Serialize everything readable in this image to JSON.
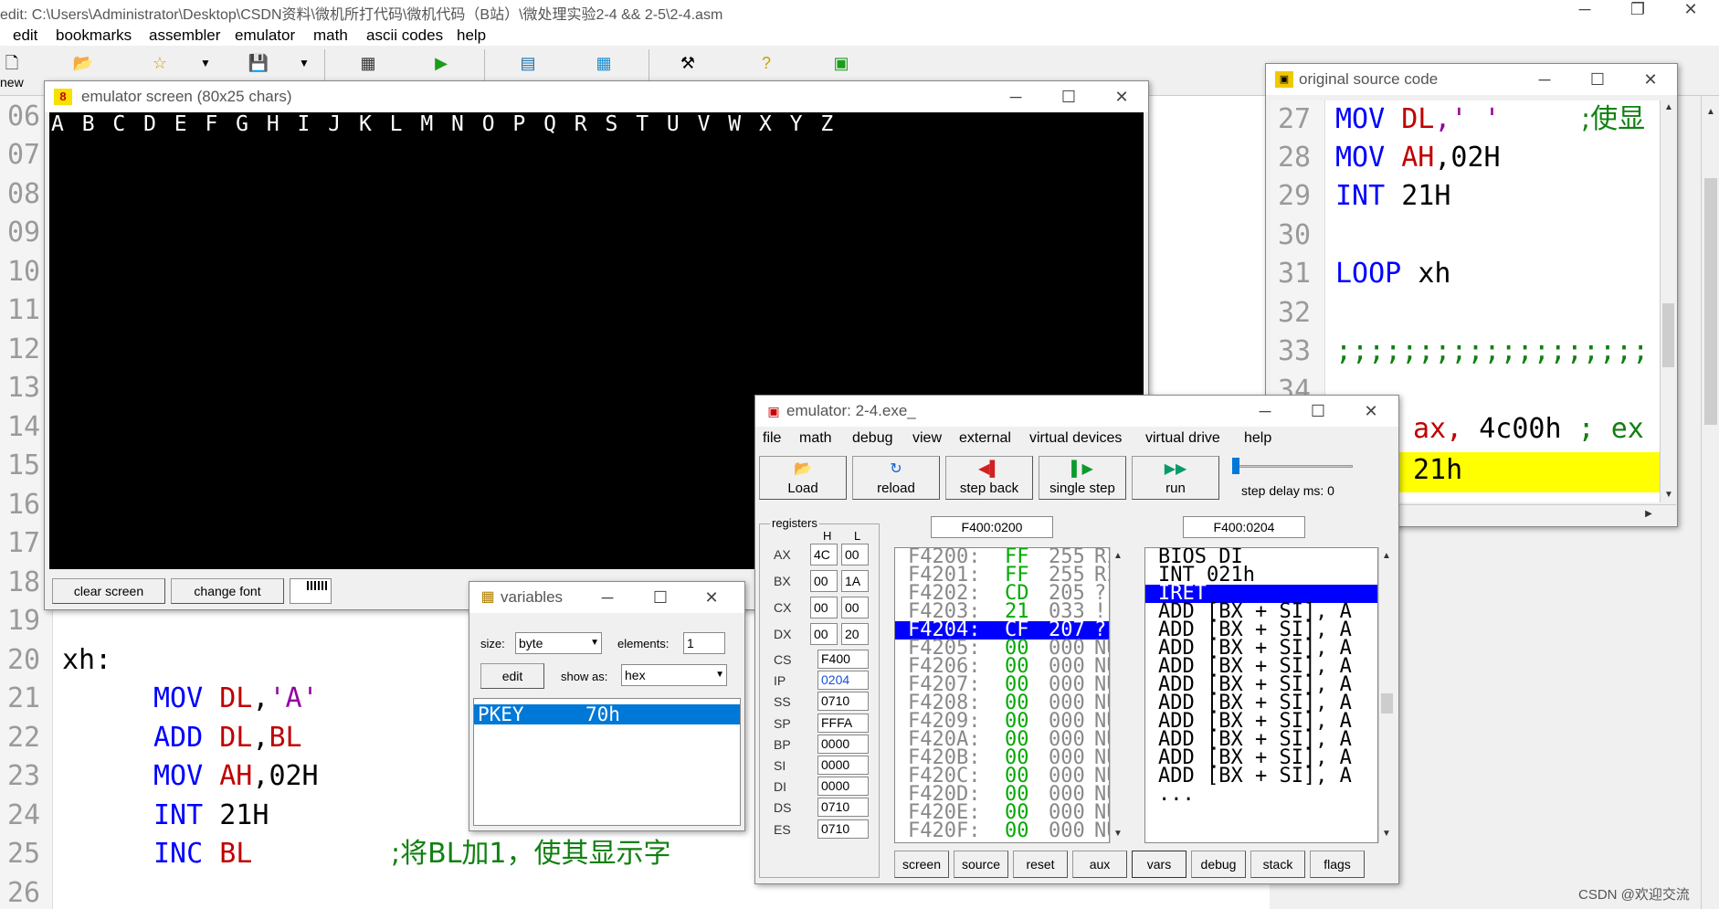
{
  "main": {
    "title": "edit: C:\\Users\\Administrator\\Desktop\\CSDN资料\\微机所打代码\\微机代码（B站）\\微处理实验2-4 && 2-5\\2-4.asm",
    "menu": [
      "edit",
      "bookmarks",
      "assembler",
      "emulator",
      "math",
      "ascii codes",
      "help"
    ],
    "toolbar_new": "new"
  },
  "editor": {
    "line_numbers": [
      "06",
      "07",
      "08",
      "09",
      "10",
      "11",
      "12",
      "13",
      "14",
      "15",
      "16",
      "17",
      "18",
      "19",
      "20",
      "21",
      "22",
      "23",
      "24",
      "25",
      "26"
    ],
    "label_xh": "xh:",
    "lines": [
      {
        "kw": "MOV",
        "a": "DL",
        "sep": ",",
        "b": "'A'"
      },
      {
        "kw": "ADD",
        "a": "DL",
        "sep": ",",
        "b": "BL"
      },
      {
        "kw": "MOV",
        "a": "AH",
        "sep": ",",
        "b": "02H"
      },
      {
        "kw": "INT",
        "a": "",
        "sep": "",
        "b": "21H"
      },
      {
        "kw": "INC",
        "a": "BL",
        "sep": "",
        "b": ""
      }
    ],
    "comment_25": ";将BL加1，使其显示字"
  },
  "emuscreen": {
    "title": "emulator screen (80x25 chars)",
    "text": "A B C D E F G H I J K L M N O P Q R S T U V W X Y Z",
    "clear_label": "clear screen",
    "font_label": "change font"
  },
  "source": {
    "title": "original source code",
    "line_numbers": [
      "27",
      "28",
      "29",
      "30",
      "31",
      "32",
      "33",
      "34"
    ],
    "l27": {
      "kw": "MOV",
      "a": "DL",
      "b": ",' '",
      "c": ";使显"
    },
    "l28": {
      "kw": "MOV",
      "a": "AH",
      "b": ",02H"
    },
    "l29": {
      "kw": "INT",
      "b": "21H"
    },
    "l31": {
      "kw": "LOOP",
      "b": "xh"
    },
    "l33": ";;;;;;;;;;;;;;;;;;;",
    "l35": {
      "a": "ax,",
      "b": "4c00h",
      ";": ";",
      "c": "ex"
    },
    "l36": "21h"
  },
  "variables": {
    "title": "variables",
    "size_label": "size:",
    "size_value": "byte",
    "elements_label": "elements:",
    "elements_value": "1",
    "edit_label": "edit",
    "showas_label": "show as:",
    "showas_value": "hex",
    "item_name": "PKEY",
    "item_value": "70h"
  },
  "emulator": {
    "title": "emulator: 2-4.exe_",
    "menu": [
      "file",
      "math",
      "debug",
      "view",
      "external",
      "virtual devices",
      "virtual drive",
      "help"
    ],
    "buttons": {
      "load": "Load",
      "reload": "reload",
      "stepback": "step back",
      "single": "single step",
      "run": "run"
    },
    "step_delay": "step delay ms: 0",
    "registers_label": "registers",
    "hl": {
      "h": "H",
      "l": "L"
    },
    "regs8": [
      {
        "name": "AX",
        "h": "4C",
        "l": "00"
      },
      {
        "name": "BX",
        "h": "00",
        "l": "1A"
      },
      {
        "name": "CX",
        "h": "00",
        "l": "00"
      },
      {
        "name": "DX",
        "h": "00",
        "l": "20"
      }
    ],
    "regs16": [
      {
        "name": "CS",
        "v": "F400"
      },
      {
        "name": "IP",
        "v": "0204"
      },
      {
        "name": "SS",
        "v": "0710"
      },
      {
        "name": "SP",
        "v": "FFFA"
      },
      {
        "name": "BP",
        "v": "0000"
      },
      {
        "name": "SI",
        "v": "0000"
      },
      {
        "name": "DI",
        "v": "0000"
      },
      {
        "name": "DS",
        "v": "0710"
      },
      {
        "name": "ES",
        "v": "0710"
      }
    ],
    "addr_left": "F400:0200",
    "addr_right": "F400:0204",
    "mem": [
      {
        "a": "F4200:",
        "h": "FF",
        "d": "255",
        "c": "RI"
      },
      {
        "a": "F4201:",
        "h": "FF",
        "d": "255",
        "c": "RI"
      },
      {
        "a": "F4202:",
        "h": "CD",
        "d": "205",
        "c": "?"
      },
      {
        "a": "F4203:",
        "h": "21",
        "d": "033",
        "c": "!"
      },
      {
        "a": "F4204:",
        "h": "CF",
        "d": "207",
        "c": "?"
      },
      {
        "a": "F4205:",
        "h": "00",
        "d": "000",
        "c": "NU"
      },
      {
        "a": "F4206:",
        "h": "00",
        "d": "000",
        "c": "NU"
      },
      {
        "a": "F4207:",
        "h": "00",
        "d": "000",
        "c": "NU"
      },
      {
        "a": "F4208:",
        "h": "00",
        "d": "000",
        "c": "NU"
      },
      {
        "a": "F4209:",
        "h": "00",
        "d": "000",
        "c": "NU"
      },
      {
        "a": "F420A:",
        "h": "00",
        "d": "000",
        "c": "NU"
      },
      {
        "a": "F420B:",
        "h": "00",
        "d": "000",
        "c": "NU"
      },
      {
        "a": "F420C:",
        "h": "00",
        "d": "000",
        "c": "NU"
      },
      {
        "a": "F420D:",
        "h": "00",
        "d": "000",
        "c": "NU"
      },
      {
        "a": "F420E:",
        "h": "00",
        "d": "000",
        "c": "NU"
      },
      {
        "a": "F420F:",
        "h": "00",
        "d": "000",
        "c": "NU"
      }
    ],
    "dis": [
      "BIOS DI",
      "INT 021h",
      "IRET",
      "ADD [BX + SI], A",
      "ADD [BX + SI], A",
      "ADD [BX + SI], A",
      "ADD [BX + SI], A",
      "ADD [BX + SI], A",
      "ADD [BX + SI], A",
      "ADD [BX + SI], A",
      "ADD [BX + SI], A",
      "ADD [BX + SI], A",
      "ADD [BX + SI], A",
      "..."
    ],
    "bottom": [
      "screen",
      "source",
      "reset",
      "aux",
      "vars",
      "debug",
      "stack",
      "flags"
    ]
  },
  "watermark": "CSDN @欢迎交流"
}
